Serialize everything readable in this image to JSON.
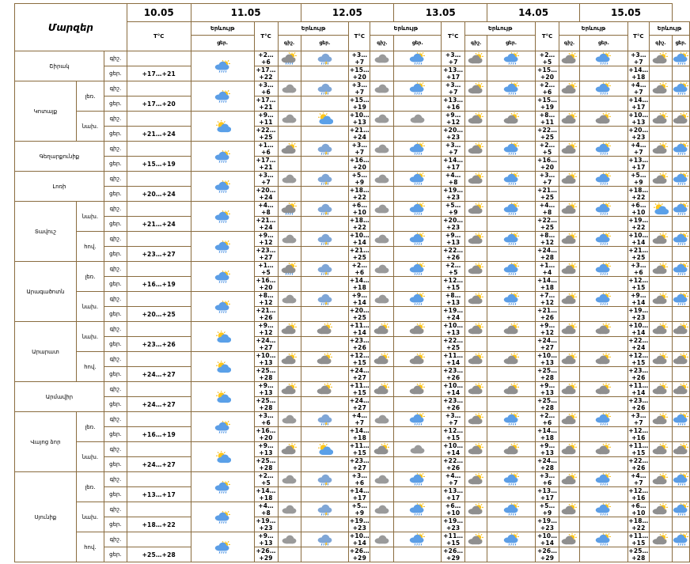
{
  "header": {
    "title": "Մարզեր",
    "dates": [
      "10.05",
      "11.05",
      "12.05",
      "13.05",
      "14.05",
      "15.05"
    ],
    "temp_label": "T°C",
    "weather_label": "Երևույթ",
    "night_short": "գիշ.",
    "day_short": "ցեր."
  },
  "labels": {
    "night": "գիշ.",
    "day": "ցեր."
  },
  "regions": [
    {
      "name": "Շիրակ",
      "groups": [
        {
          "sub": "",
          "night": {
            "temps": [
              "",
              "+2…+6",
              "+3…+7",
              "+3…+7",
              "+2…+5",
              "+3…+7"
            ],
            "icons": [
              "cloud-sun",
              "storm-sun",
              "cloud",
              "cloud-sun",
              "cloud-sun",
              "cloud-sun"
            ]
          },
          "day": {
            "temps": [
              "+17…+21",
              "+17…+22",
              "+15…+20",
              "+13…+17",
              "+15…+20",
              "+14…+18"
            ],
            "icons": [
              "cloud-sun-rain",
              "storm-rain",
              "rain-cloud",
              "rain-cloud",
              "rain-cloud",
              "rain-cloud"
            ]
          }
        }
      ]
    },
    {
      "name": "Կոտայք",
      "groups": [
        {
          "sub": "լեռ.",
          "night": {
            "temps": [
              "",
              "+3…+6",
              "+3…+7",
              "+3…+7",
              "+2…+6",
              "+4…+7"
            ],
            "icons": [
              "cloud-sun",
              "cloud",
              "cloud",
              "cloud-sun",
              "cloud-sun",
              "cloud-sun"
            ]
          },
          "day": {
            "temps": [
              "+17…+20",
              "+17…+21",
              "+15…+19",
              "+13…+16",
              "+15…+19",
              "+14…+17"
            ],
            "icons": [
              "cloud-sun-rain",
              "storm-rain",
              "rain-cloud",
              "rain-cloud",
              "rain-cloud",
              "rain-cloud"
            ]
          }
        },
        {
          "sub": "նախ.",
          "night": {
            "temps": [
              "",
              "+9…+11",
              "+10…+13",
              "+9…+12",
              "+8…+11",
              "+10…+13"
            ],
            "icons": [
              "sun-cloud",
              "cloud",
              "cloud",
              "cloud-sun",
              "cloud-sun",
              "cloud-sun"
            ]
          },
          "day": {
            "temps": [
              "+21…+24",
              "+22…+25",
              "+21…+24",
              "+20…+23",
              "+22…+25",
              "+20…+23"
            ],
            "icons": [
              "sun-cloud",
              "sun-cloud",
              "cloud",
              "cloud-sun",
              "cloud-sun",
              "cloud-sun"
            ]
          }
        }
      ]
    },
    {
      "name": "Գեղարքունիք",
      "groups": [
        {
          "sub": "",
          "night": {
            "temps": [
              "",
              "+1…+6",
              "+3…+7",
              "+3…+7",
              "+2…+5",
              "+4…+7"
            ],
            "icons": [
              "cloud-sun",
              "cloud-sun",
              "cloud",
              "cloud-sun",
              "cloud-sun",
              "cloud-sun"
            ]
          },
          "day": {
            "temps": [
              "+15…+19",
              "+17…+21",
              "+16…+20",
              "+14…+17",
              "+16…+20",
              "+13…+17"
            ],
            "icons": [
              "cloud-sun-rain",
              "storm-rain",
              "rain-cloud",
              "rain-cloud",
              "rain-cloud",
              "rain-cloud"
            ]
          }
        }
      ]
    },
    {
      "name": "Լոռի",
      "groups": [
        {
          "sub": "",
          "night": {
            "temps": [
              "",
              "+3…+7",
              "+5…+9",
              "+4…+8",
              "+3…+7",
              "+5…+9"
            ],
            "icons": [
              "cloud-sun",
              "cloud",
              "cloud",
              "cloud-sun",
              "cloud-sun",
              "cloud-sun"
            ]
          },
          "day": {
            "temps": [
              "+20…+24",
              "+20…+24",
              "+18…+22",
              "+19…+23",
              "+21…+25",
              "+18…+22"
            ],
            "icons": [
              "cloud-sun-rain",
              "storm-rain",
              "rain-cloud",
              "rain-cloud",
              "rain-cloud",
              "rain-cloud"
            ]
          }
        }
      ]
    },
    {
      "name": "Տավուշ",
      "groups": [
        {
          "sub": "նախ.",
          "night": {
            "temps": [
              "",
              "+4…+8",
              "+6…+10",
              "+5…+9",
              "+4…+8",
              "+6…+10"
            ],
            "icons": [
              "cloud-sun",
              "storm-sun",
              "cloud",
              "cloud-sun",
              "cloud-sun",
              "sun-cloud"
            ]
          },
          "day": {
            "temps": [
              "+21…+24",
              "+21…+24",
              "+18…+22",
              "+20…+23",
              "+22…+25",
              "+19…+22"
            ],
            "icons": [
              "cloud-sun-rain",
              "storm-rain",
              "rain-cloud",
              "rain-cloud",
              "rain-cloud",
              "rain-cloud"
            ]
          }
        },
        {
          "sub": "հով.",
          "night": {
            "temps": [
              "",
              "+9…+12",
              "+10…+14",
              "+9…+13",
              "+8…+12",
              "+10…+14"
            ],
            "icons": [
              "cloud-sun",
              "cloud",
              "cloud",
              "cloud-sun",
              "cloud-sun",
              "cloud-sun"
            ]
          },
          "day": {
            "temps": [
              "+23…+27",
              "+23…+27",
              "+21…+25",
              "+22…+26",
              "+24…+28",
              "+21…+25"
            ],
            "icons": [
              "cloud-sun-rain",
              "storm-rain",
              "rain-cloud",
              "rain-cloud",
              "rain-cloud",
              "rain-cloud"
            ]
          }
        }
      ]
    },
    {
      "name": "Արագածոտն",
      "groups": [
        {
          "sub": "լեռ.",
          "night": {
            "temps": [
              "",
              "+1…+5",
              "+2…+6",
              "+2…+5",
              "+1…+4",
              "+3…+6"
            ],
            "icons": [
              "cloud-sun",
              "storm-sun",
              "cloud",
              "cloud-sun",
              "cloud-sun",
              "cloud-sun"
            ]
          },
          "day": {
            "temps": [
              "+16…+19",
              "+16…+20",
              "+14…+18",
              "+12…+15",
              "+14…+18",
              "+12…+15"
            ],
            "icons": [
              "cloud-sun-rain",
              "storm-rain",
              "rain-cloud",
              "rain-cloud",
              "rain-cloud",
              "rain-cloud"
            ]
          }
        },
        {
          "sub": "նախ.",
          "night": {
            "temps": [
              "",
              "+8…+12",
              "+9…+14",
              "+8…+13",
              "+7…+12",
              "+9…+14"
            ],
            "icons": [
              "cloud-sun",
              "cloud",
              "cloud",
              "cloud-sun",
              "cloud-sun",
              "cloud-sun"
            ]
          },
          "day": {
            "temps": [
              "+20…+25",
              "+21…+26",
              "+20…+25",
              "+19…+24",
              "+21…+26",
              "+19…+23"
            ],
            "icons": [
              "cloud-sun-rain",
              "storm-rain",
              "rain-cloud",
              "rain-cloud",
              "rain-cloud",
              "rain-cloud"
            ]
          }
        }
      ]
    },
    {
      "name": "Արարատ",
      "groups": [
        {
          "sub": "նախ.",
          "night": {
            "temps": [
              "",
              "+9…+12",
              "+11…+14",
              "+10…+13",
              "+9…+12",
              "+10…+14"
            ],
            "icons": [
              "sun-cloud",
              "cloud-sun",
              "cloud-sun",
              "cloud-sun",
              "cloud-sun",
              "cloud-sun"
            ]
          },
          "day": {
            "temps": [
              "+23…+26",
              "+24…+27",
              "+23…+26",
              "+22…+25",
              "+24…+27",
              "+22…+24"
            ],
            "icons": [
              "sun-cloud",
              "cloud-sun",
              "cloud-sun",
              "cloud-sun",
              "cloud-sun",
              "cloud-sun"
            ]
          }
        },
        {
          "sub": "հով.",
          "night": {
            "temps": [
              "",
              "+10…+13",
              "+12…+15",
              "+11…+14",
              "+10…+13",
              "+12…+15"
            ],
            "icons": [
              "sun-cloud",
              "cloud-sun",
              "cloud-sun",
              "cloud-sun",
              "cloud-sun",
              "cloud-sun"
            ]
          },
          "day": {
            "temps": [
              "+24…+27",
              "+25…+28",
              "+24…+27",
              "+23…+26",
              "+25…+28",
              "+23…+26"
            ],
            "icons": [
              "sun-cloud",
              "cloud-sun",
              "cloud-sun",
              "cloud-sun",
              "cloud-sun",
              "cloud-sun"
            ]
          }
        }
      ]
    },
    {
      "name": "Արմավիր",
      "groups": [
        {
          "sub": "",
          "night": {
            "temps": [
              "",
              "+9…+13",
              "+11…+15",
              "+10…+14",
              "+9…+13",
              "+11…+14"
            ],
            "icons": [
              "sun-cloud",
              "cloud-sun",
              "cloud-sun",
              "cloud-sun",
              "cloud-sun",
              "cloud-sun"
            ]
          },
          "day": {
            "temps": [
              "+24…+27",
              "+25…+28",
              "+24…+27",
              "+23…+26",
              "+25…+28",
              "+23…+26"
            ],
            "icons": [
              "sun-cloud",
              "cloud-sun",
              "cloud-sun",
              "cloud-sun",
              "cloud-sun",
              "cloud-sun"
            ]
          }
        }
      ]
    },
    {
      "name": "Վայոց ձոր",
      "groups": [
        {
          "sub": "լեռ.",
          "night": {
            "temps": [
              "",
              "+3…+6",
              "+4…+7",
              "+3…+7",
              "+2…+6",
              "+3…+7"
            ],
            "icons": [
              "cloud-sun",
              "cloud",
              "cloud",
              "cloud-sun",
              "cloud-sun",
              "cloud-sun"
            ]
          },
          "day": {
            "temps": [
              "+16…+19",
              "+16…+20",
              "+14…+18",
              "+12…+15",
              "+14…+18",
              "+12…+16"
            ],
            "icons": [
              "cloud-sun-rain",
              "storm-rain",
              "rain-cloud",
              "rain-cloud",
              "rain-cloud",
              "rain-cloud"
            ]
          }
        },
        {
          "sub": "նախ.",
          "night": {
            "temps": [
              "",
              "+9…+13",
              "+11…+15",
              "+10…+14",
              "+9…+13",
              "+11…+15"
            ],
            "icons": [
              "sun-cloud",
              "cloud-sun",
              "cloud-sun",
              "cloud-sun",
              "cloud-sun",
              "cloud-sun"
            ]
          },
          "day": {
            "temps": [
              "+24…+27",
              "+25…+28",
              "+23…+27",
              "+22…+26",
              "+24…+28",
              "+22…+26"
            ],
            "icons": [
              "sun-cloud",
              "sun-cloud",
              "cloud",
              "cloud-sun",
              "cloud-sun",
              "cloud-sun"
            ]
          }
        }
      ]
    },
    {
      "name": "Սյունիք",
      "groups": [
        {
          "sub": "լեռ.",
          "night": {
            "temps": [
              "",
              "+2…+5",
              "+3…+6",
              "+4…+7",
              "+3…+6",
              "+4…+7"
            ],
            "icons": [
              "cloud-sun",
              "cloud",
              "cloud",
              "cloud-sun",
              "cloud-sun",
              "cloud-sun"
            ]
          },
          "day": {
            "temps": [
              "+13…+17",
              "+14…+18",
              "+14…+17",
              "+13…+17",
              "+13…+17",
              "+12…+16"
            ],
            "icons": [
              "cloud-sun-rain",
              "storm-rain",
              "rain-cloud",
              "rain-cloud",
              "rain-cloud",
              "rain-cloud"
            ]
          }
        },
        {
          "sub": "նախ.",
          "night": {
            "temps": [
              "",
              "+4…+8",
              "+5…+9",
              "+6…+10",
              "+5…+9",
              "+6…+10"
            ],
            "icons": [
              "cloud-sun",
              "cloud",
              "cloud",
              "cloud-sun",
              "cloud-sun",
              "cloud-sun"
            ]
          },
          "day": {
            "temps": [
              "+18…+22",
              "+19…+23",
              "+19…+23",
              "+19…+23",
              "+19…+23",
              "+18…+22"
            ],
            "icons": [
              "cloud-sun-rain",
              "storm-rain",
              "rain-cloud",
              "rain-cloud",
              "rain-cloud",
              "rain-cloud"
            ]
          }
        },
        {
          "sub": "հով.",
          "night": {
            "temps": [
              "",
              "+9…+13",
              "+10…+14",
              "+11…+15",
              "+10…+14",
              "+11…+15"
            ],
            "icons": [
              "sun-cloud",
              "cloud",
              "cloud",
              "cloud-sun",
              "cloud-sun",
              "cloud-sun"
            ]
          },
          "day": {
            "temps": [
              "+25…+28",
              "+26…+29",
              "+26…+29",
              "+26…+29",
              "+26…+29",
              "+25…+28"
            ],
            "icons": [
              "cloud-sun-rain",
              "storm-rain",
              "rain-cloud",
              "rain-cloud",
              "rain-cloud",
              "rain-cloud"
            ]
          }
        }
      ]
    }
  ]
}
